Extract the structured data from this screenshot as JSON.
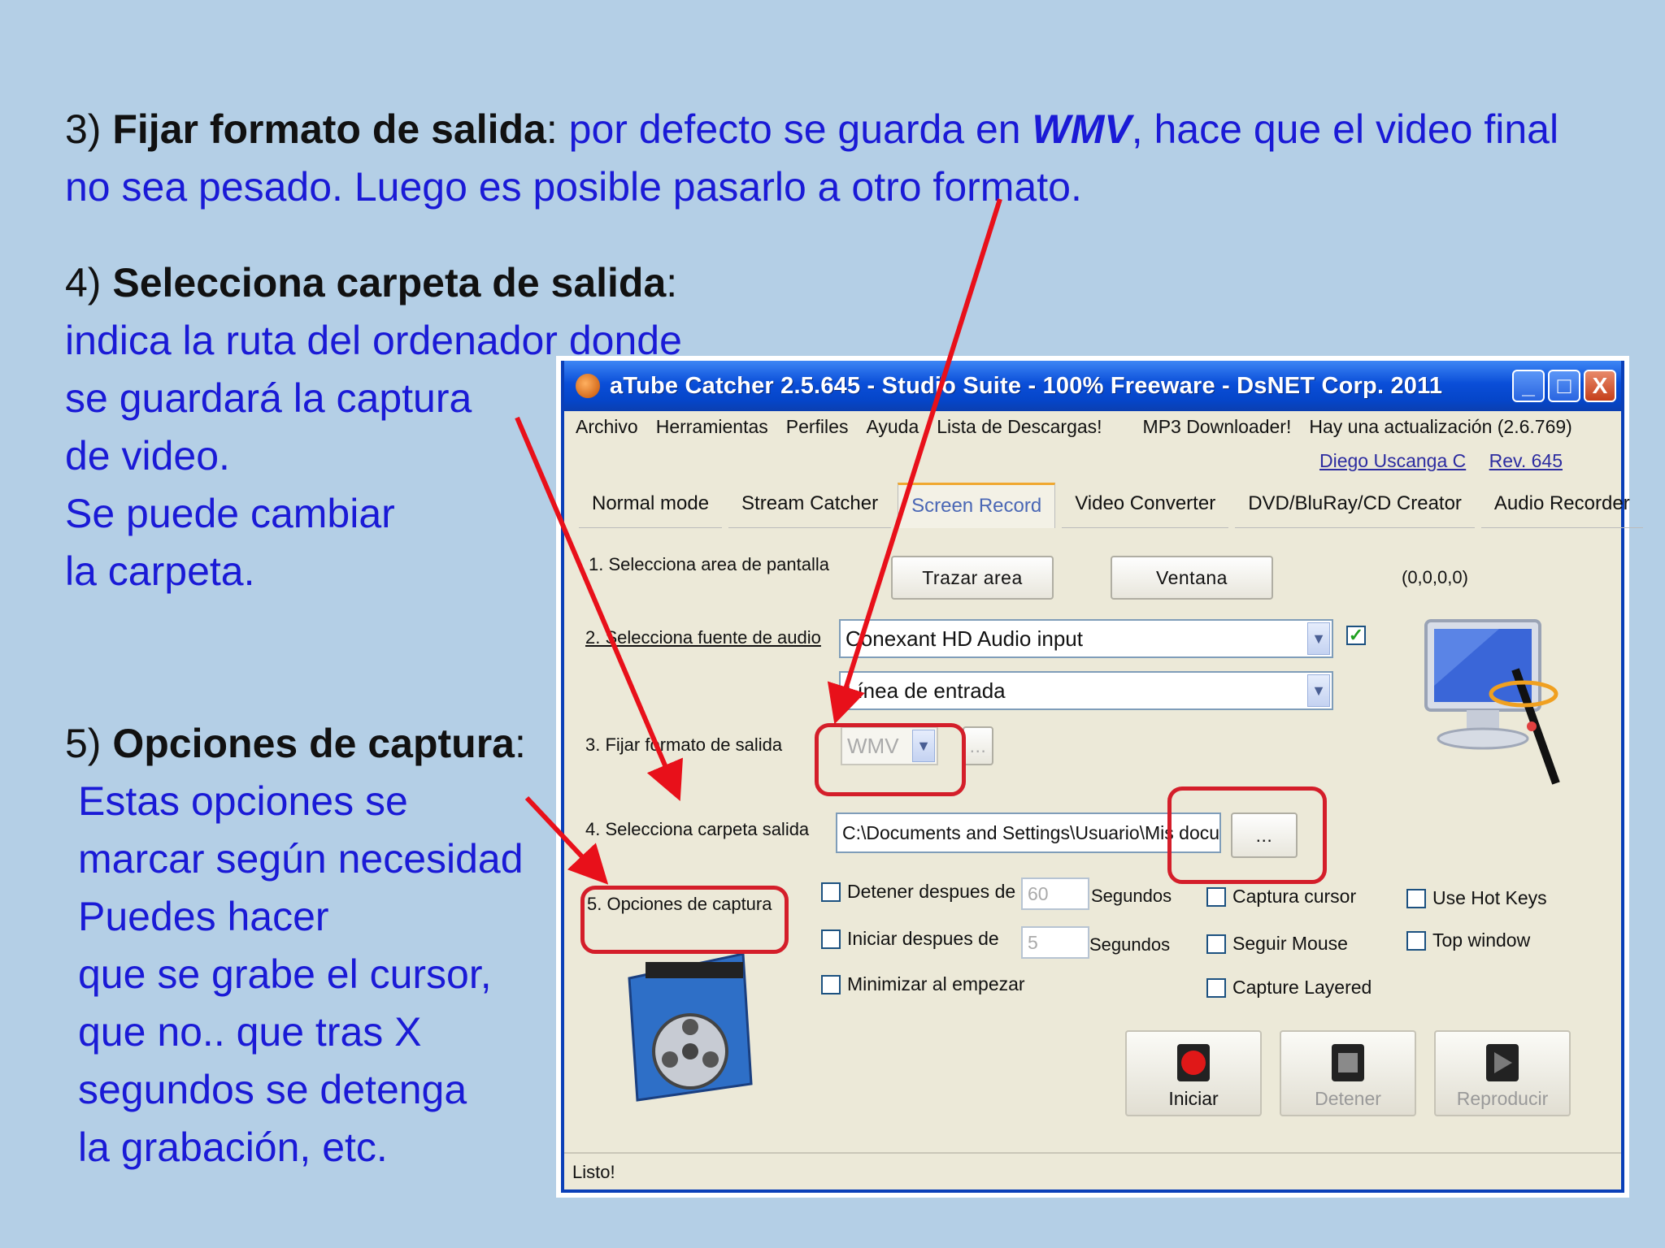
{
  "slide": {
    "block3": {
      "num": "3)",
      "heading": "Fijar formato de salida",
      "colon": ":",
      "text_a": " por defecto se guarda en ",
      "format": "WMV",
      "text_b": ",  hace que el video final no sea pesado. Luego es posible pasarlo a otro formato."
    },
    "block4": {
      "num": "4)",
      "heading": "Selecciona carpeta de salida",
      "colon": ":",
      "lines": [
        "indica la ruta del ordenador  donde",
        "se guardará la captura",
        "de video.",
        "Se puede  cambiar",
        "la carpeta."
      ]
    },
    "block5": {
      "num": "5)",
      "heading": "Opciones de captura",
      "colon": ":",
      "lines": [
        "Estas opciones se",
        "marcar según  necesidad",
        "Puedes hacer",
        "que se grabe el cursor,",
        "que no.. que tras X",
        "segundos se detenga",
        "la grabación, etc."
      ]
    }
  },
  "window": {
    "title": "aTube Catcher 2.5.645 - Studio Suite - 100% Freeware - DsNET Corp. 2011",
    "controls": {
      "minimize": "_",
      "maximize": "□",
      "close": "X"
    },
    "menu": [
      "Archivo",
      "Herramientas",
      "Perfiles",
      "Ayuda",
      "Lista de Descargas!",
      "MP3 Downloader!",
      "Hay una actualización (2.6.769)"
    ],
    "links": [
      "Diego Uscanga C",
      "Rev. 645"
    ],
    "tabs": [
      "Normal mode",
      "Stream Catcher",
      "Screen Record",
      "Video Converter",
      "DVD/BluRay/CD Creator",
      "Audio Recorder"
    ],
    "active_tab": "Screen Record",
    "step1": {
      "label": "1. Selecciona area de pantalla",
      "btn_area": "Trazar area",
      "btn_window": "Ventana",
      "coords": "(0,0,0,0)"
    },
    "step2": {
      "label": "2. Selecciona fuente de audio",
      "audio_source": "Conexant HD Audio input",
      "audio_line": "Línea de entrada",
      "enabled": true
    },
    "step3": {
      "label": "3. Fijar formato de salida",
      "format": "WMV",
      "btn_more": "..."
    },
    "step4": {
      "label": "4. Selecciona carpeta salida",
      "path": "C:\\Documents and Settings\\Usuario\\Mis docum",
      "btn_browse": "..."
    },
    "step5": {
      "label": "5. Opciones de captura",
      "stop_after": {
        "label": "Detener despues de",
        "value": "60",
        "unit": "Segundos",
        "checked": false
      },
      "start_after": {
        "label": "Iniciar despues de",
        "value": "5",
        "unit": "Segundos",
        "checked": false
      },
      "minimize": {
        "label": "Minimizar al empezar",
        "checked": false
      },
      "capture_cursor": {
        "label": "Captura cursor",
        "checked": false
      },
      "follow_mouse": {
        "label": "Seguir Mouse",
        "checked": false
      },
      "capture_layered": {
        "label": "Capture Layered",
        "checked": false
      },
      "hot_keys": {
        "label": "Use Hot Keys",
        "checked": false
      },
      "top_window": {
        "label": "Top window",
        "checked": false
      }
    },
    "buttons": {
      "start": "Iniciar",
      "stop": "Detener",
      "play": "Reproducir"
    },
    "status": "Listo!"
  },
  "colors": {
    "background": "#b4cfe6",
    "text_blue": "#1a1ad6",
    "annotation_red": "#e8101a",
    "titlebar": "#0a4ed8"
  }
}
